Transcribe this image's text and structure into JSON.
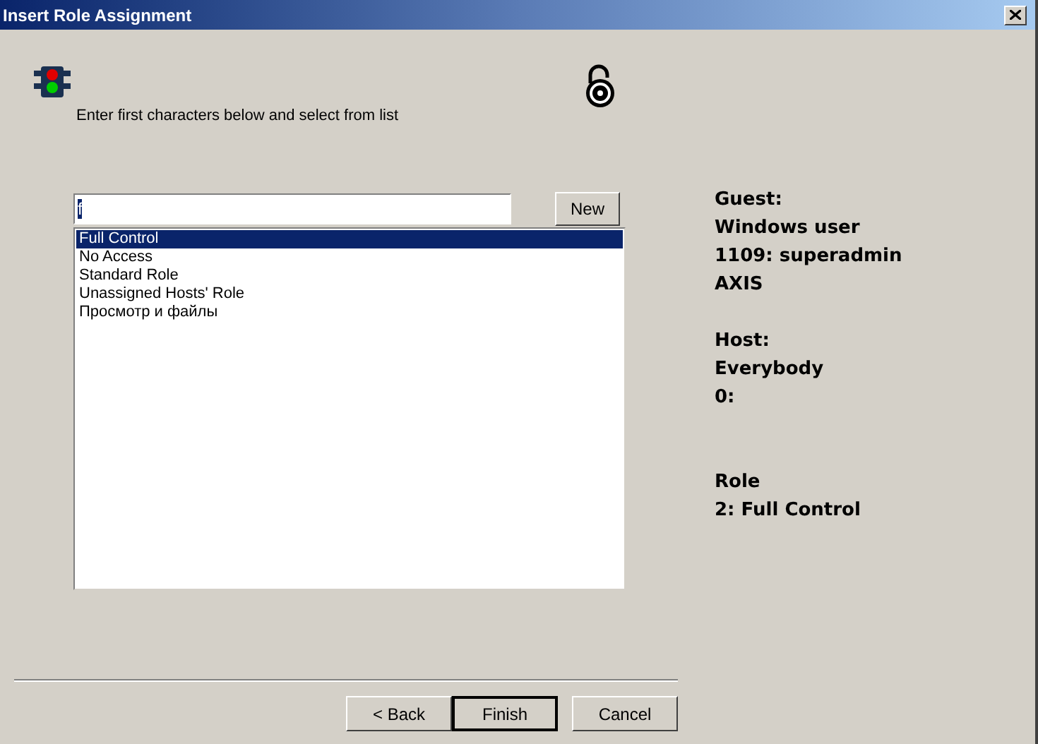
{
  "window": {
    "title": "Insert Role Assignment"
  },
  "instruction": "Enter first characters below and select from list",
  "search": {
    "value": "f"
  },
  "new_button": "New",
  "roles": [
    {
      "label": "Full Control",
      "selected": true
    },
    {
      "label": "No Access",
      "selected": false
    },
    {
      "label": "Standard Role",
      "selected": false
    },
    {
      "label": "Unassigned Hosts' Role",
      "selected": false
    },
    {
      "label": "Просмотр и файлы",
      "selected": false
    }
  ],
  "info_groups": [
    [
      "Guest:",
      "Windows user",
      "1109: superadmin",
      "AXIS"
    ],
    [
      "Host:",
      "Everybody",
      "0:"
    ],
    [
      "Role",
      "2: Full Control"
    ]
  ],
  "buttons": [
    {
      "label": "< Back",
      "default": false
    },
    {
      "label": "Finish",
      "default": true
    },
    {
      "label": "Cancel",
      "default": false
    }
  ]
}
